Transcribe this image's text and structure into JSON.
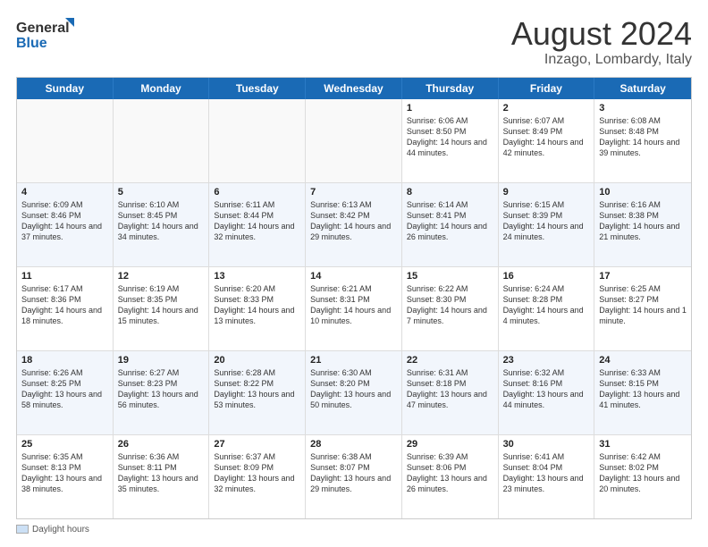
{
  "header": {
    "logo_line1": "General",
    "logo_line2": "Blue",
    "main_title": "August 2024",
    "subtitle": "Inzago, Lombardy, Italy"
  },
  "calendar": {
    "days_of_week": [
      "Sunday",
      "Monday",
      "Tuesday",
      "Wednesday",
      "Thursday",
      "Friday",
      "Saturday"
    ],
    "weeks": [
      {
        "alt": false,
        "cells": [
          {
            "day": "",
            "sunrise": "",
            "sunset": "",
            "daylight": ""
          },
          {
            "day": "",
            "sunrise": "",
            "sunset": "",
            "daylight": ""
          },
          {
            "day": "",
            "sunrise": "",
            "sunset": "",
            "daylight": ""
          },
          {
            "day": "",
            "sunrise": "",
            "sunset": "",
            "daylight": ""
          },
          {
            "day": "1",
            "sunrise": "Sunrise: 6:06 AM",
            "sunset": "Sunset: 8:50 PM",
            "daylight": "Daylight: 14 hours and 44 minutes."
          },
          {
            "day": "2",
            "sunrise": "Sunrise: 6:07 AM",
            "sunset": "Sunset: 8:49 PM",
            "daylight": "Daylight: 14 hours and 42 minutes."
          },
          {
            "day": "3",
            "sunrise": "Sunrise: 6:08 AM",
            "sunset": "Sunset: 8:48 PM",
            "daylight": "Daylight: 14 hours and 39 minutes."
          }
        ]
      },
      {
        "alt": true,
        "cells": [
          {
            "day": "4",
            "sunrise": "Sunrise: 6:09 AM",
            "sunset": "Sunset: 8:46 PM",
            "daylight": "Daylight: 14 hours and 37 minutes."
          },
          {
            "day": "5",
            "sunrise": "Sunrise: 6:10 AM",
            "sunset": "Sunset: 8:45 PM",
            "daylight": "Daylight: 14 hours and 34 minutes."
          },
          {
            "day": "6",
            "sunrise": "Sunrise: 6:11 AM",
            "sunset": "Sunset: 8:44 PM",
            "daylight": "Daylight: 14 hours and 32 minutes."
          },
          {
            "day": "7",
            "sunrise": "Sunrise: 6:13 AM",
            "sunset": "Sunset: 8:42 PM",
            "daylight": "Daylight: 14 hours and 29 minutes."
          },
          {
            "day": "8",
            "sunrise": "Sunrise: 6:14 AM",
            "sunset": "Sunset: 8:41 PM",
            "daylight": "Daylight: 14 hours and 26 minutes."
          },
          {
            "day": "9",
            "sunrise": "Sunrise: 6:15 AM",
            "sunset": "Sunset: 8:39 PM",
            "daylight": "Daylight: 14 hours and 24 minutes."
          },
          {
            "day": "10",
            "sunrise": "Sunrise: 6:16 AM",
            "sunset": "Sunset: 8:38 PM",
            "daylight": "Daylight: 14 hours and 21 minutes."
          }
        ]
      },
      {
        "alt": false,
        "cells": [
          {
            "day": "11",
            "sunrise": "Sunrise: 6:17 AM",
            "sunset": "Sunset: 8:36 PM",
            "daylight": "Daylight: 14 hours and 18 minutes."
          },
          {
            "day": "12",
            "sunrise": "Sunrise: 6:19 AM",
            "sunset": "Sunset: 8:35 PM",
            "daylight": "Daylight: 14 hours and 15 minutes."
          },
          {
            "day": "13",
            "sunrise": "Sunrise: 6:20 AM",
            "sunset": "Sunset: 8:33 PM",
            "daylight": "Daylight: 14 hours and 13 minutes."
          },
          {
            "day": "14",
            "sunrise": "Sunrise: 6:21 AM",
            "sunset": "Sunset: 8:31 PM",
            "daylight": "Daylight: 14 hours and 10 minutes."
          },
          {
            "day": "15",
            "sunrise": "Sunrise: 6:22 AM",
            "sunset": "Sunset: 8:30 PM",
            "daylight": "Daylight: 14 hours and 7 minutes."
          },
          {
            "day": "16",
            "sunrise": "Sunrise: 6:24 AM",
            "sunset": "Sunset: 8:28 PM",
            "daylight": "Daylight: 14 hours and 4 minutes."
          },
          {
            "day": "17",
            "sunrise": "Sunrise: 6:25 AM",
            "sunset": "Sunset: 8:27 PM",
            "daylight": "Daylight: 14 hours and 1 minute."
          }
        ]
      },
      {
        "alt": true,
        "cells": [
          {
            "day": "18",
            "sunrise": "Sunrise: 6:26 AM",
            "sunset": "Sunset: 8:25 PM",
            "daylight": "Daylight: 13 hours and 58 minutes."
          },
          {
            "day": "19",
            "sunrise": "Sunrise: 6:27 AM",
            "sunset": "Sunset: 8:23 PM",
            "daylight": "Daylight: 13 hours and 56 minutes."
          },
          {
            "day": "20",
            "sunrise": "Sunrise: 6:28 AM",
            "sunset": "Sunset: 8:22 PM",
            "daylight": "Daylight: 13 hours and 53 minutes."
          },
          {
            "day": "21",
            "sunrise": "Sunrise: 6:30 AM",
            "sunset": "Sunset: 8:20 PM",
            "daylight": "Daylight: 13 hours and 50 minutes."
          },
          {
            "day": "22",
            "sunrise": "Sunrise: 6:31 AM",
            "sunset": "Sunset: 8:18 PM",
            "daylight": "Daylight: 13 hours and 47 minutes."
          },
          {
            "day": "23",
            "sunrise": "Sunrise: 6:32 AM",
            "sunset": "Sunset: 8:16 PM",
            "daylight": "Daylight: 13 hours and 44 minutes."
          },
          {
            "day": "24",
            "sunrise": "Sunrise: 6:33 AM",
            "sunset": "Sunset: 8:15 PM",
            "daylight": "Daylight: 13 hours and 41 minutes."
          }
        ]
      },
      {
        "alt": false,
        "cells": [
          {
            "day": "25",
            "sunrise": "Sunrise: 6:35 AM",
            "sunset": "Sunset: 8:13 PM",
            "daylight": "Daylight: 13 hours and 38 minutes."
          },
          {
            "day": "26",
            "sunrise": "Sunrise: 6:36 AM",
            "sunset": "Sunset: 8:11 PM",
            "daylight": "Daylight: 13 hours and 35 minutes."
          },
          {
            "day": "27",
            "sunrise": "Sunrise: 6:37 AM",
            "sunset": "Sunset: 8:09 PM",
            "daylight": "Daylight: 13 hours and 32 minutes."
          },
          {
            "day": "28",
            "sunrise": "Sunrise: 6:38 AM",
            "sunset": "Sunset: 8:07 PM",
            "daylight": "Daylight: 13 hours and 29 minutes."
          },
          {
            "day": "29",
            "sunrise": "Sunrise: 6:39 AM",
            "sunset": "Sunset: 8:06 PM",
            "daylight": "Daylight: 13 hours and 26 minutes."
          },
          {
            "day": "30",
            "sunrise": "Sunrise: 6:41 AM",
            "sunset": "Sunset: 8:04 PM",
            "daylight": "Daylight: 13 hours and 23 minutes."
          },
          {
            "day": "31",
            "sunrise": "Sunrise: 6:42 AM",
            "sunset": "Sunset: 8:02 PM",
            "daylight": "Daylight: 13 hours and 20 minutes."
          }
        ]
      }
    ]
  },
  "footer": {
    "daylight_label": "Daylight hours"
  }
}
